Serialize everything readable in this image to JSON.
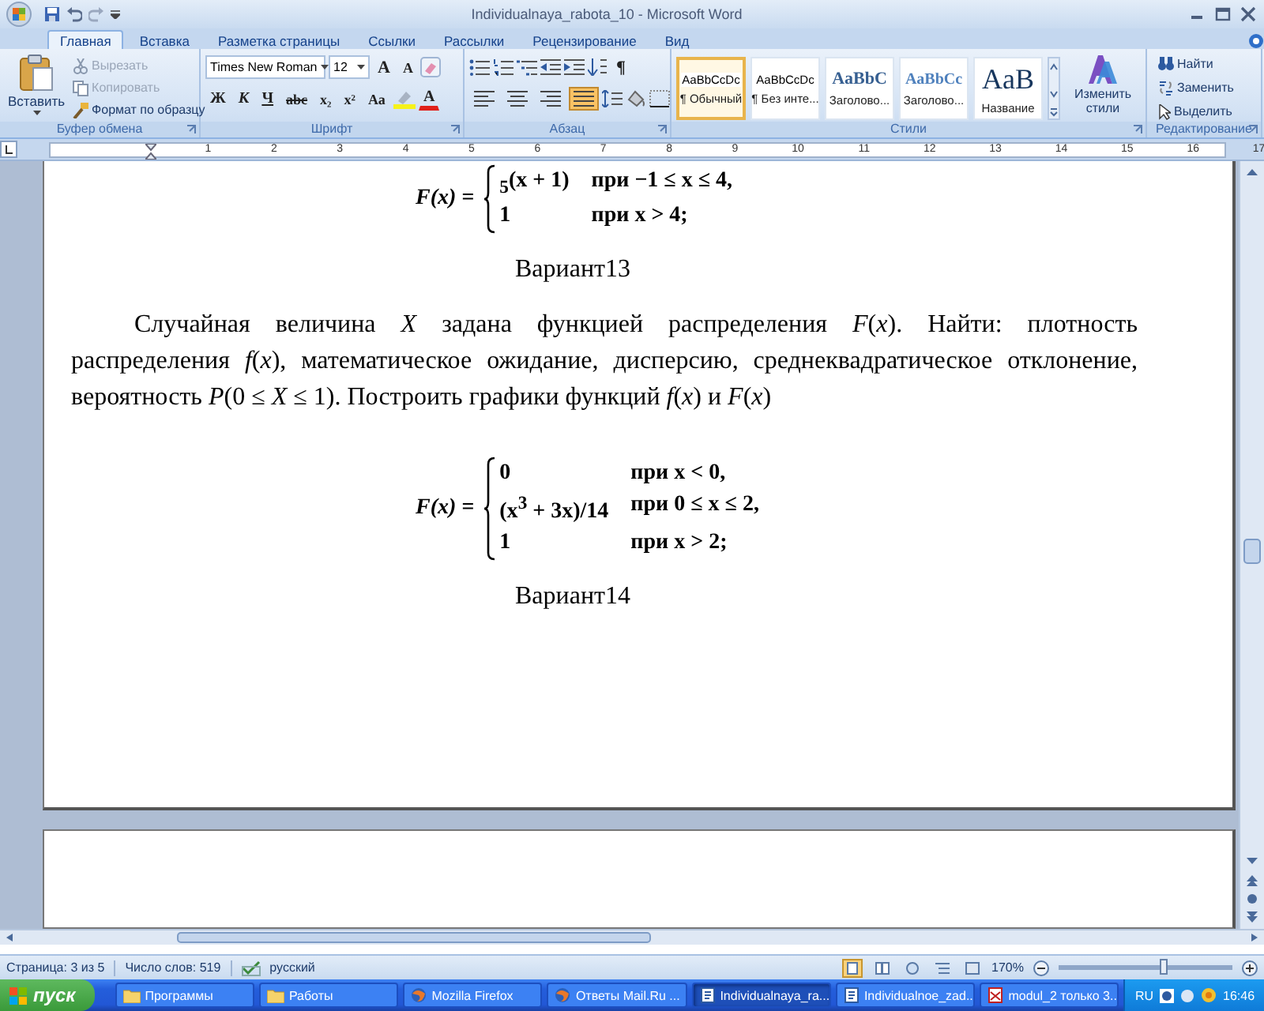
{
  "window": {
    "title": "Individualnaya_rabota_10 - Microsoft Word"
  },
  "ribbon_tabs": [
    {
      "label": "Главная",
      "selected": true
    },
    {
      "label": "Вставка",
      "selected": false
    },
    {
      "label": "Разметка страницы",
      "selected": false
    },
    {
      "label": "Ссылки",
      "selected": false
    },
    {
      "label": "Рассылки",
      "selected": false
    },
    {
      "label": "Рецензирование",
      "selected": false
    },
    {
      "label": "Вид",
      "selected": false
    }
  ],
  "clipboard": {
    "group_label": "Буфер обмена",
    "paste": "Вставить",
    "items": [
      {
        "kind": "cut",
        "label": "Вырезать",
        "disabled": true
      },
      {
        "kind": "copy",
        "label": "Копировать",
        "disabled": true
      },
      {
        "kind": "brush",
        "label": "Формат по образцу",
        "disabled": false
      }
    ]
  },
  "font": {
    "group_label": "Шрифт",
    "name": "Times New Roman",
    "size": "12",
    "size_tools": [
      "A",
      "A"
    ],
    "format_tools": [
      "Ж",
      "К",
      "Ч",
      "abc",
      "x₂",
      "x²",
      "Aa"
    ],
    "color_tool": "A"
  },
  "paragraph": {
    "group_label": "Абзац",
    "pilcrow": "¶",
    "alignments": [
      {
        "kind": "left",
        "selected": false
      },
      {
        "kind": "center",
        "selected": false
      },
      {
        "kind": "right",
        "selected": false
      },
      {
        "kind": "justify",
        "selected": true
      }
    ]
  },
  "styles": {
    "group_label": "Стили",
    "items": [
      {
        "kind": "normal",
        "sample": "AaBbCcDc",
        "label": "¶ Обычный",
        "selected": true
      },
      {
        "kind": "normal",
        "sample": "AaBbCcDc",
        "label": "¶ Без инте...",
        "selected": false
      },
      {
        "kind": "heading1",
        "sample": "AaBbC",
        "label": "Заголово...",
        "selected": false
      },
      {
        "kind": "heading2",
        "sample": "AaBbCc",
        "label": "Заголово...",
        "selected": false
      },
      {
        "kind": "title",
        "sample": "AaB",
        "label": "Название",
        "selected": false
      }
    ],
    "change": "Изменить стили"
  },
  "editing": {
    "group_label": "Редактирование",
    "items": [
      {
        "kind": "find",
        "label": "Найти"
      },
      {
        "kind": "replace",
        "label": "Заменить"
      },
      {
        "kind": "select",
        "label": "Выделить"
      }
    ]
  },
  "ruler": {
    "marks": [
      "1",
      "2",
      "3",
      "4",
      "5",
      "6",
      "7",
      "8",
      "9",
      "10",
      "11",
      "12",
      "13",
      "14",
      "15",
      "16",
      "17"
    ]
  },
  "document": {
    "blocks": [
      {
        "kind": "formula",
        "label": "F(x) =",
        "rows": [
          {
            "expr": "$_{5}$(x + 1)",
            "cond": "при  −1 ≤ x ≤ 4,"
          },
          {
            "expr": "1",
            "cond": "при  x > 4;"
          }
        ]
      },
      {
        "kind": "heading",
        "text": "Вариант13"
      },
      {
        "kind": "paragraph",
        "text": "Случайная величина *X* задана функцией распределения *F*(*x*). Найти: плотность распределения *f*(*x*), математическое ожидание, дисперсию, среднеквадратическое отклонение, вероятность *P*(0 ≤ *X* ≤ 1). Построить графики функций *f*(*x*) и *F*(*x*)"
      },
      {
        "kind": "formula",
        "label": "F(x) =",
        "rows": [
          {
            "expr": "0",
            "cond": "при  x < 0,"
          },
          {
            "expr": "(x$^{3}$ + 3x)/14",
            "cond": "при  0 ≤ x ≤ 2,"
          },
          {
            "expr": "1",
            "cond": "при  x > 2;"
          }
        ]
      },
      {
        "kind": "heading",
        "text": "Вариант14"
      }
    ]
  },
  "status_bar": {
    "page": "Страница: 3 из 5",
    "words": "Число слов: 519",
    "language": "русский",
    "views": [
      {
        "kind": "print",
        "selected": true
      },
      {
        "kind": "reading",
        "selected": false
      },
      {
        "kind": "web",
        "selected": false
      },
      {
        "kind": "outline",
        "selected": false
      },
      {
        "kind": "draft",
        "selected": false
      }
    ],
    "zoom": "170%",
    "zoom_slider": {
      "level": 0.6
    }
  },
  "taskbar": {
    "start": "пуск",
    "items": [
      {
        "kind": "folder",
        "label": "Программы",
        "selected": false
      },
      {
        "kind": "folder",
        "label": "Работы",
        "selected": false
      },
      {
        "kind": "browser",
        "label": "Mozilla Firefox",
        "selected": false
      },
      {
        "kind": "browser",
        "label": "Ответы Mail.Ru ...",
        "selected": false
      },
      {
        "kind": "word",
        "label": "Individualnaya_ra...",
        "selected": true
      },
      {
        "kind": "word",
        "label": "Individualnoe_zad...",
        "selected": false
      },
      {
        "kind": "pdf",
        "label": "modul_2 только 3...",
        "selected": false
      }
    ],
    "language": "RU",
    "time": "16:46"
  }
}
